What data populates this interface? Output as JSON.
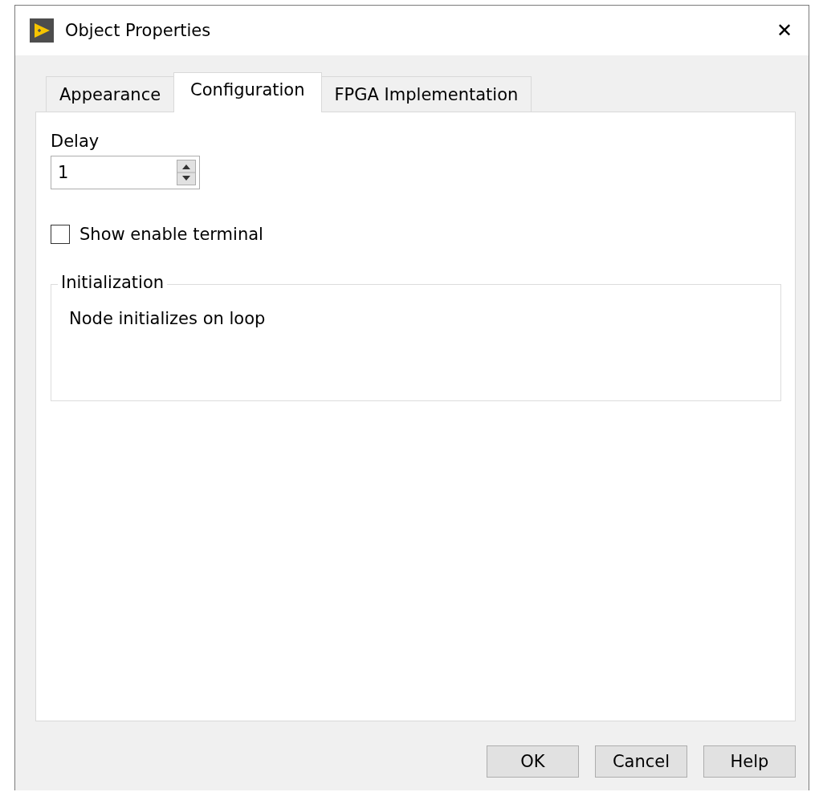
{
  "window": {
    "title": "Object Properties",
    "close": "✕"
  },
  "tabs": [
    {
      "label": "Appearance",
      "selected": false
    },
    {
      "label": "Configuration",
      "selected": true
    },
    {
      "label": "FPGA Implementation",
      "selected": false
    }
  ],
  "delay": {
    "label": "Delay",
    "value": "1"
  },
  "show_enable_terminal": {
    "label": "Show enable terminal",
    "checked": false
  },
  "initialization": {
    "title": "Initialization",
    "text": "Node initializes on loop"
  },
  "buttons": [
    "OK",
    "Cancel",
    "Help"
  ]
}
